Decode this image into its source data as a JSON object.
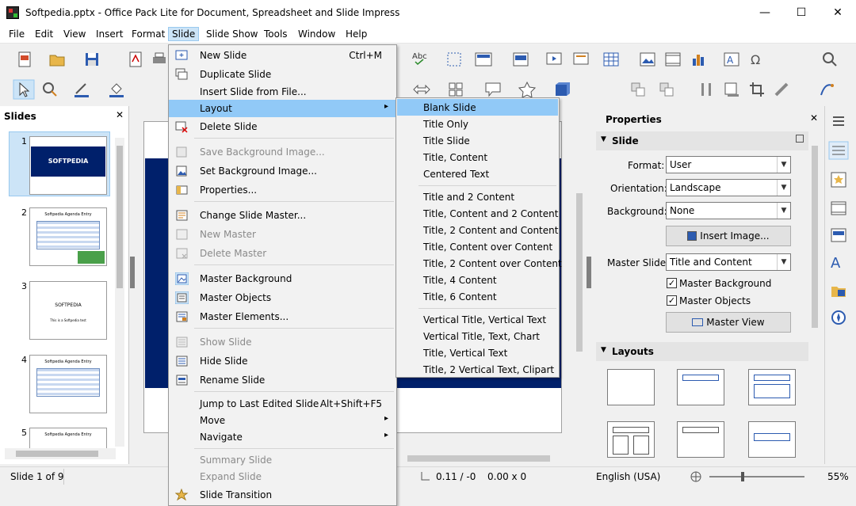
{
  "window": {
    "title": "Softpedia.pptx - Office Pack Lite for Document, Spreadsheet and Slide Impress",
    "minimize": "—",
    "maximize": "☐",
    "close": "✕"
  },
  "menubar": [
    "File",
    "Edit",
    "View",
    "Insert",
    "Format",
    "Slide",
    "Slide Show",
    "Tools",
    "Window",
    "Help"
  ],
  "slides_pane": {
    "title": "Slides",
    "close": "✕",
    "thumbnails": [
      {
        "num": "1",
        "text": "SOFTPEDIA"
      },
      {
        "num": "2",
        "text": "Softpedia Agenda Entry"
      },
      {
        "num": "3",
        "text": "SOFTPEDIA",
        "sub": "This is a Softpedia test"
      },
      {
        "num": "4",
        "text": "Softpedia Agenda Entry"
      },
      {
        "num": "5",
        "text": "Softpedia Agenda Entry"
      }
    ]
  },
  "slide_menu": {
    "items": [
      {
        "label": "New Slide",
        "shortcut": "Ctrl+M",
        "disabled": false
      },
      {
        "label": "Duplicate Slide",
        "disabled": false
      },
      {
        "label": "Insert Slide from File...",
        "disabled": false
      },
      {
        "label": "Layout",
        "submenu": true,
        "highlight": true
      },
      {
        "label": "Delete Slide",
        "disabled": false
      },
      {
        "label": "Save Background Image...",
        "disabled": true
      },
      {
        "label": "Set Background Image...",
        "disabled": false
      },
      {
        "label": "Properties...",
        "disabled": false
      },
      {
        "label": "Change Slide Master...",
        "disabled": false
      },
      {
        "label": "New Master",
        "disabled": true
      },
      {
        "label": "Delete Master",
        "disabled": true
      },
      {
        "label": "Master Background",
        "disabled": false
      },
      {
        "label": "Master Objects",
        "disabled": false
      },
      {
        "label": "Master Elements...",
        "disabled": false
      },
      {
        "label": "Show Slide",
        "disabled": true
      },
      {
        "label": "Hide Slide",
        "disabled": false
      },
      {
        "label": "Rename Slide",
        "disabled": false
      },
      {
        "label": "Jump to Last Edited Slide",
        "shortcut": "Alt+Shift+F5",
        "disabled": false
      },
      {
        "label": "Move",
        "submenu": true
      },
      {
        "label": "Navigate",
        "submenu": true
      },
      {
        "label": "Summary Slide",
        "disabled": true
      },
      {
        "label": "Expand Slide",
        "disabled": true
      },
      {
        "label": "Slide Transition",
        "disabled": false
      }
    ]
  },
  "layout_menu": {
    "items": [
      "Blank Slide",
      "Title Only",
      "Title Slide",
      "Title, Content",
      "Centered Text",
      "Title and 2 Content",
      "Title, Content and 2 Content",
      "Title, 2 Content and Content",
      "Title, Content over Content",
      "Title, 2 Content over Content",
      "Title, 4 Content",
      "Title, 6 Content",
      "Vertical Title, Vertical Text",
      "Vertical Title, Text, Chart",
      "Title, Vertical Text",
      "Title, 2 Vertical Text, Clipart"
    ]
  },
  "properties": {
    "title": "Properties",
    "close": "✕",
    "slide_section": "Slide",
    "format_label": "Format:",
    "format_value": "User",
    "orientation_label": "Orientation:",
    "orientation_value": "Landscape",
    "background_label": "Background:",
    "background_value": "None",
    "insert_image": "Insert Image...",
    "master_slide_label": "Master Slide:",
    "master_slide_value": "Title and Content",
    "master_background": "Master Background",
    "master_objects": "Master Objects",
    "master_view": "Master View",
    "layouts_section": "Layouts"
  },
  "status": {
    "slide": "Slide 1 of 9",
    "position": "0.11 / -0",
    "size": "0.00 x 0",
    "language": "English (USA)",
    "zoom": "55%"
  },
  "colors": {
    "slide_band": "#00206b",
    "highlight": "#91c9f7"
  }
}
